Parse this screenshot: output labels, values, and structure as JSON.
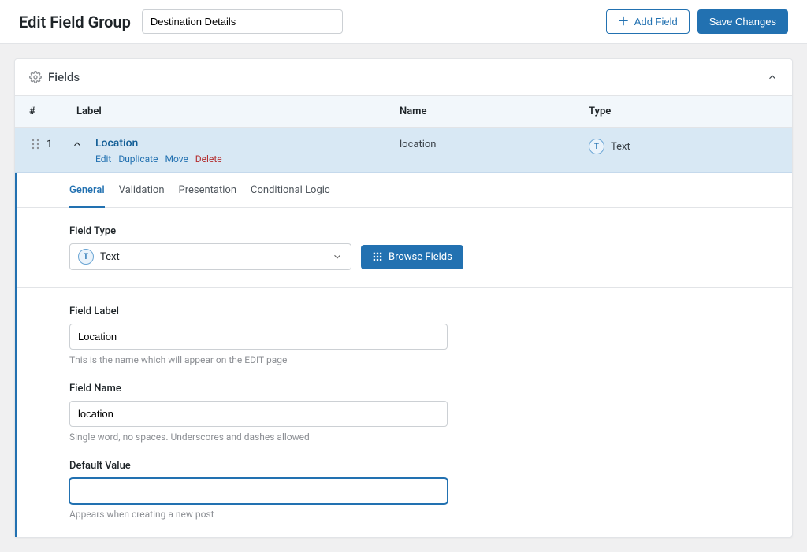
{
  "header": {
    "title": "Edit Field Group",
    "group_name": "Destination Details",
    "add_field": "Add Field",
    "save": "Save Changes"
  },
  "panel": {
    "title": "Fields",
    "columns": {
      "num": "#",
      "label": "Label",
      "name": "Name",
      "type": "Type"
    }
  },
  "row": {
    "index": "1",
    "label": "Location",
    "name": "location",
    "type": "Text",
    "type_badge": "T",
    "actions": {
      "edit": "Edit",
      "duplicate": "Duplicate",
      "move": "Move",
      "delete": "Delete"
    }
  },
  "tabs": {
    "general": "General",
    "validation": "Validation",
    "presentation": "Presentation",
    "conditional": "Conditional Logic"
  },
  "editor": {
    "fieldType": {
      "label": "Field Type",
      "value": "Text",
      "badge": "T",
      "browse": "Browse Fields"
    },
    "fieldLabel": {
      "label": "Field Label",
      "value": "Location",
      "hint": "This is the name which will appear on the EDIT page"
    },
    "fieldName": {
      "label": "Field Name",
      "value": "location",
      "hint": "Single word, no spaces. Underscores and dashes allowed"
    },
    "defaultValue": {
      "label": "Default Value",
      "value": "",
      "hint": "Appears when creating a new post"
    }
  }
}
